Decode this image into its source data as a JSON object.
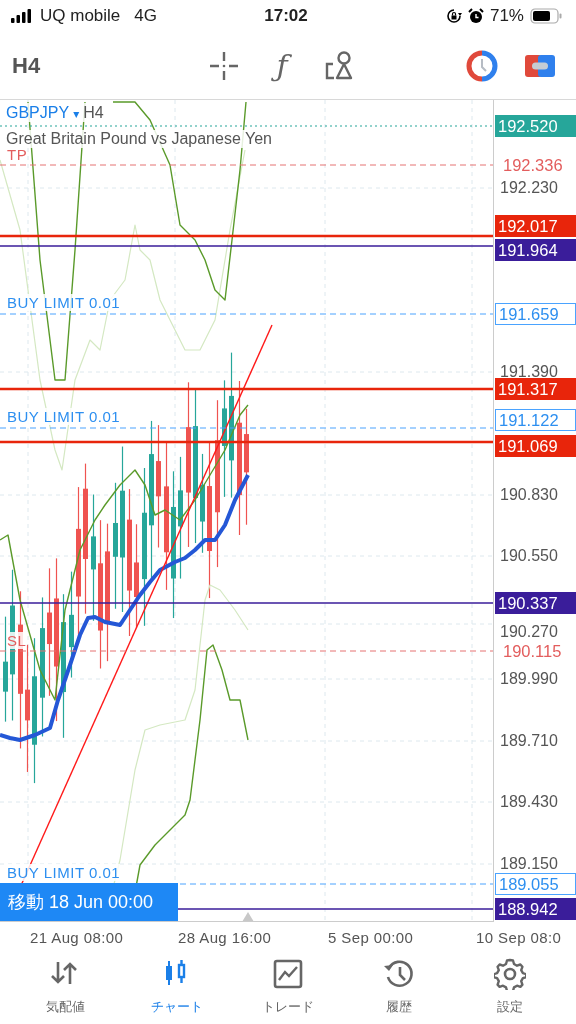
{
  "status_bar": {
    "carrier": "UQ mobile",
    "network": "4G",
    "time": "17:02",
    "battery": "71%"
  },
  "toolbar": {
    "timeframe": "H4",
    "function_glyph": "ƒ"
  },
  "chart": {
    "symbol": "GBPJPY",
    "symbol_caret": "▾",
    "timeframe": "H4",
    "description": "Great Britain Pound vs Japanese Yen",
    "price_ticks": [
      "192.230",
      "191.390",
      "190.830",
      "190.550",
      "190.270",
      "189.990",
      "189.710",
      "189.430",
      "189.150"
    ],
    "price_lines": [
      {
        "kind": "bid",
        "value": "192.520"
      },
      {
        "kind": "tp",
        "tag": "TP",
        "value": "192.336"
      },
      {
        "kind": "alert",
        "value": "192.017"
      },
      {
        "kind": "level",
        "value": "191.964"
      },
      {
        "kind": "order",
        "tag": "BUY LIMIT 0.01",
        "value": "191.659"
      },
      {
        "kind": "alert",
        "value": "191.317"
      },
      {
        "kind": "order",
        "tag": "BUY LIMIT 0.01",
        "value": "191.122"
      },
      {
        "kind": "alert",
        "value": "191.069"
      },
      {
        "kind": "level",
        "value": "190.337"
      },
      {
        "kind": "sl",
        "tag": "SL",
        "value": "190.115"
      },
      {
        "kind": "order",
        "tag": "BUY LIMIT 0.01",
        "value": "189.055"
      },
      {
        "kind": "level",
        "value": "188.942"
      }
    ],
    "cursor_label": "移動 18 Jun 00:00",
    "time_ticks": [
      "21 Aug 08:00",
      "28 Aug 16:00",
      "5 Sep 00:00",
      "10 Sep 08:0"
    ]
  },
  "tabs": [
    {
      "label": "気配値",
      "selected": false
    },
    {
      "label": "チャート",
      "selected": true
    },
    {
      "label": "トレード",
      "selected": false
    },
    {
      "label": "履歴",
      "selected": false
    },
    {
      "label": "設定",
      "selected": false
    }
  ]
}
